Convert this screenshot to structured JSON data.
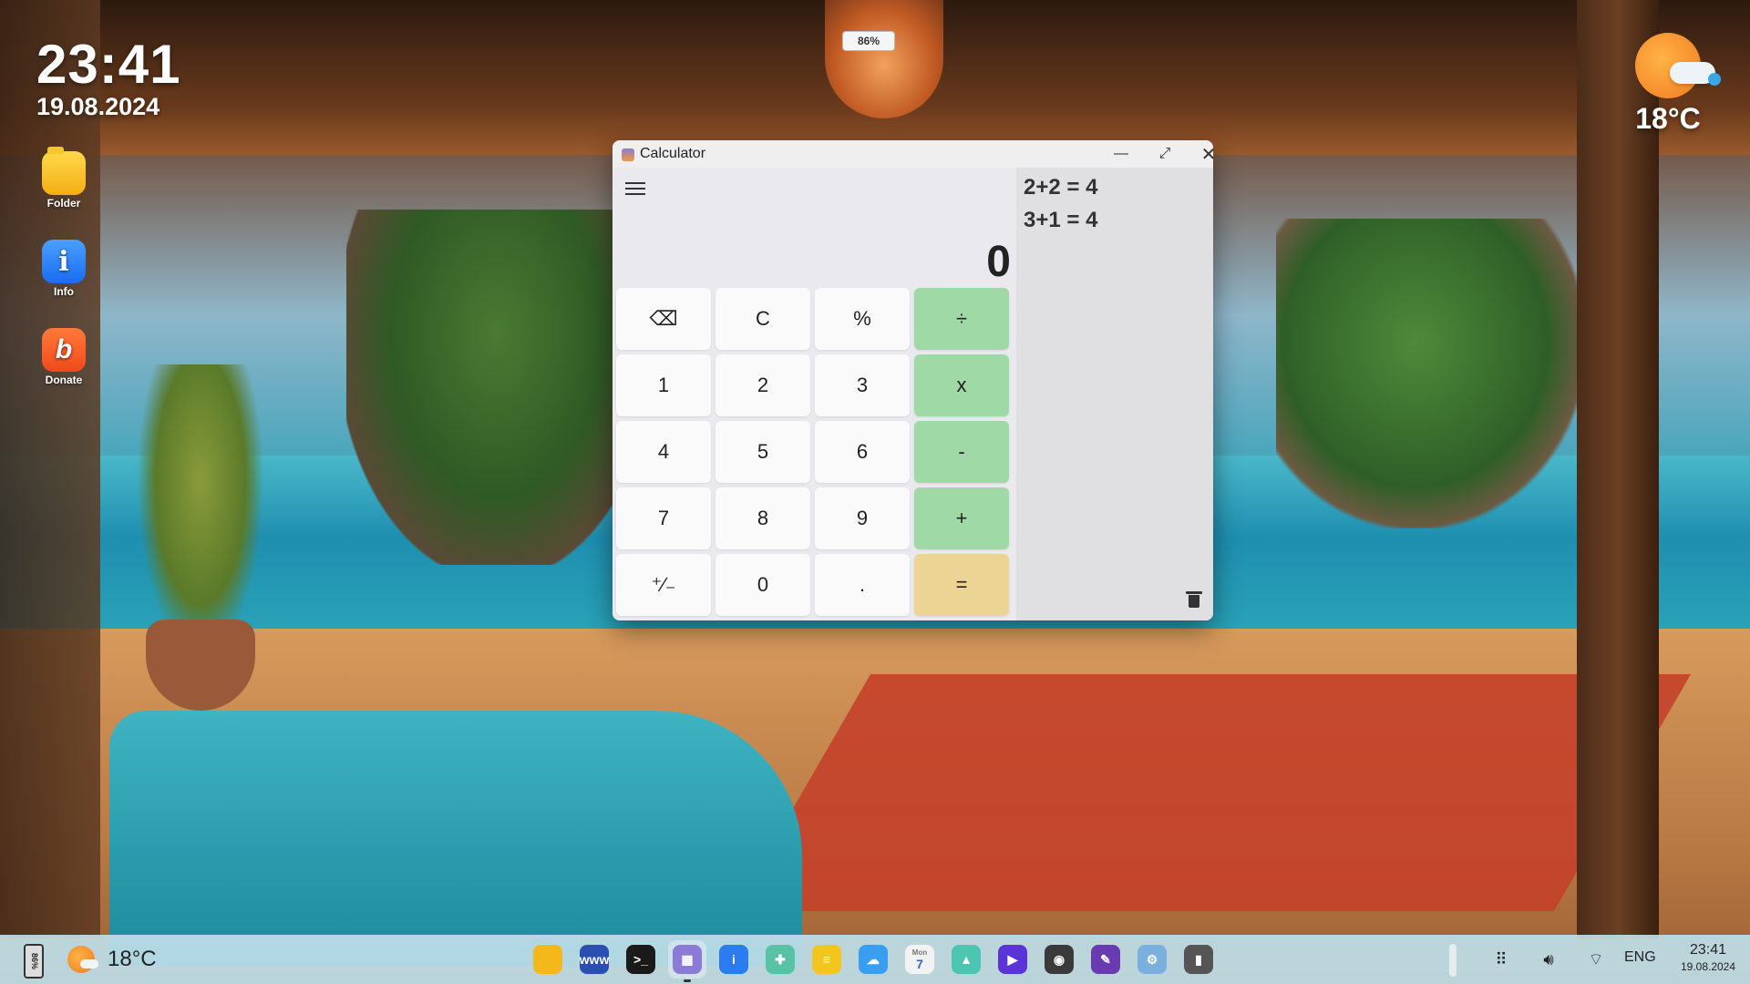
{
  "desktop": {
    "clock_time": "23:41",
    "clock_date": "19.08.2024",
    "weather_temp": "18°C",
    "battery_percent": "86%",
    "icons": [
      {
        "label": "Folder",
        "icon": "folder-icon"
      },
      {
        "label": "Info",
        "icon": "info-icon"
      },
      {
        "label": "Donate",
        "icon": "donate-icon"
      }
    ]
  },
  "calculator": {
    "title": "Calculator",
    "display": "0",
    "keys": [
      "⌫",
      "C",
      "%",
      "÷",
      "1",
      "2",
      "3",
      "x",
      "4",
      "5",
      "6",
      "-",
      "7",
      "8",
      "9",
      "+",
      "⁺∕₋",
      "0",
      ".",
      "="
    ],
    "history": [
      "2+2 = 4",
      "3+1 = 4"
    ],
    "colors": {
      "operator": "#9ed9a6",
      "equals": "#ecd594",
      "digit": "#fafafa"
    }
  },
  "taskbar": {
    "battery": "86%",
    "weather_temp": "18°C",
    "apps": [
      {
        "name": "files",
        "icon": "folder-icon",
        "color": "#f4b81c",
        "glyph": ""
      },
      {
        "name": "browser",
        "icon": "globe-icon",
        "color": "#2b4fb0",
        "glyph": "www"
      },
      {
        "name": "terminal",
        "icon": "terminal-icon",
        "color": "#1a1a1a",
        "glyph": ">_"
      },
      {
        "name": "calculator",
        "icon": "calculator-icon",
        "color": "#8c7bd6",
        "glyph": "▦"
      },
      {
        "name": "info",
        "icon": "info-icon",
        "color": "#2a7cf0",
        "glyph": "i"
      },
      {
        "name": "games",
        "icon": "gamepad-icon",
        "color": "#58c3a4",
        "glyph": "✚"
      },
      {
        "name": "notes",
        "icon": "list-icon",
        "color": "#f4c51c",
        "glyph": "≡"
      },
      {
        "name": "weather",
        "icon": "weather-icon",
        "color": "#3a9ef0",
        "glyph": "☁"
      },
      {
        "name": "calendar",
        "icon": "calendar-icon",
        "color": "#f2f2f2",
        "glyph": "7"
      },
      {
        "name": "photos",
        "icon": "image-icon",
        "color": "#4cc6b0",
        "glyph": "▲"
      },
      {
        "name": "video",
        "icon": "play-icon",
        "color": "#5a34d8",
        "glyph": "▶"
      },
      {
        "name": "camera",
        "icon": "camera-icon",
        "color": "#3a3a3a",
        "glyph": "◉"
      },
      {
        "name": "paint",
        "icon": "paint-icon",
        "color": "#6a3ab0",
        "glyph": "✎"
      },
      {
        "name": "settings",
        "icon": "settings-icon",
        "color": "#7ab0e0",
        "glyph": "⚙"
      },
      {
        "name": "trash",
        "icon": "trash-icon",
        "color": "#555555",
        "glyph": "▮"
      }
    ],
    "active_app": "calculator",
    "calendar_month": "Mon",
    "lang": "ENG",
    "time": "23:41",
    "date": "19.08.2024"
  }
}
